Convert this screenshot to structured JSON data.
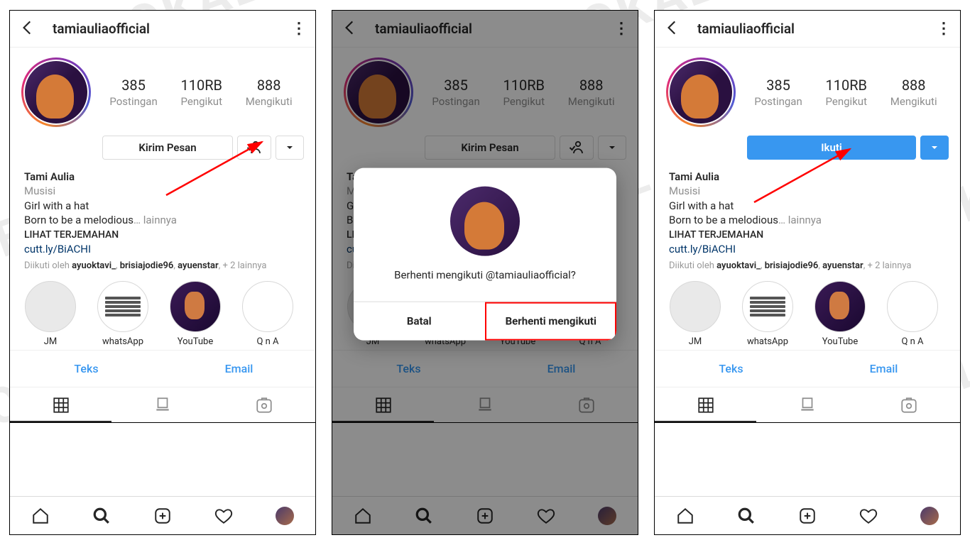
{
  "watermark": "BEROKAL",
  "header": {
    "username": "tamiauliaofficial"
  },
  "stats": {
    "posts": {
      "num": "385",
      "lab": "Postingan"
    },
    "followers": {
      "num": "110RB",
      "lab": "Pengikut"
    },
    "following": {
      "num": "888",
      "lab": "Mengikuti"
    }
  },
  "buttons": {
    "message": "Kirim Pesan",
    "follow": "Ikuti"
  },
  "bio": {
    "name": "Tami Aulia",
    "category": "Musisi",
    "line1": "Girl with a hat",
    "line2": "Born to be a melodious",
    "more": "… lainnya",
    "translate": "LIHAT TERJEMAHAN",
    "link": "cutt.ly/BiACHI"
  },
  "followed_by": {
    "prefix": "Diikuti oleh",
    "n1": "ayuoktavi_",
    "n2": "brisiajodie96",
    "n3": "ayuenstar",
    "suffix": ", + 2 lainnya"
  },
  "highlights": {
    "h1": "JM",
    "h2": "whatsApp",
    "h3": "YouTube",
    "h4": "Q n A"
  },
  "contact": {
    "text": "Teks",
    "email": "Email"
  },
  "modal": {
    "text": "Berhenti mengikuti @tamiauliaofficial?",
    "cancel": "Batal",
    "confirm": "Berhenti mengikuti"
  }
}
